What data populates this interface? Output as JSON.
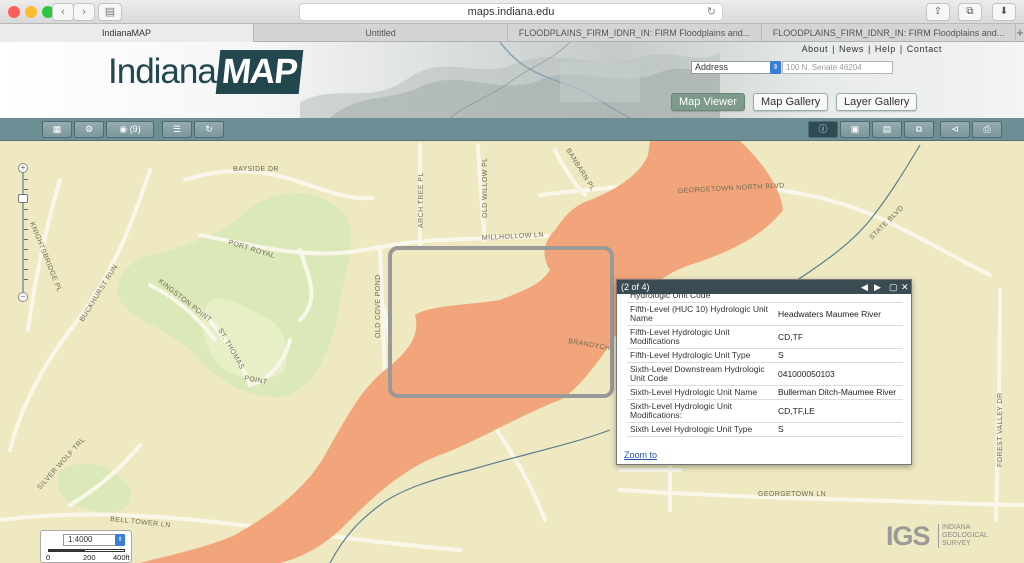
{
  "browser": {
    "url": "maps.indiana.edu",
    "tabs": [
      {
        "label": "IndianaMAP",
        "active": true
      },
      {
        "label": "Untitled",
        "active": false
      },
      {
        "label": "FLOODPLAINS_FIRM_IDNR_IN: FIRM Floodplains and...",
        "active": false
      },
      {
        "label": "FLOODPLAINS_FIRM_IDNR_IN: FIRM Floodplains and...",
        "active": false
      }
    ]
  },
  "header": {
    "logo_part1": "Indiana",
    "logo_part2": "MAP",
    "links": [
      "About",
      "|",
      "News",
      "|",
      "Help",
      "|",
      "Contact"
    ],
    "search_type": "Address",
    "search_placeholder": "100 N. Senate 46204",
    "buttons": {
      "map_viewer": "Map Viewer",
      "map_gallery": "Map Gallery",
      "layer_gallery": "Layer Gallery"
    }
  },
  "toolbar": {
    "layers_count": "(9)"
  },
  "map": {
    "street_labels": [
      "BAYSIDE DR",
      "ARCH TREE PL",
      "OLD WILLOW PL",
      "BANBARN PL",
      "GEORGETOWN NORTH BLVD",
      "STATE BLVD",
      "PORT ROYAL",
      "MILLHOLLOW LN",
      "KNIGHTSBRIDGE PL",
      "BUCKHURST RUN",
      "KINGSTON POINT",
      "ST. THOMAS",
      "POINT",
      "OLD COVE POND",
      "BRANDYCH",
      "SILVER WOLF TRL",
      "BELL TOWER LN",
      "GEORGETOWN LN",
      "FOREST VALLEY DR"
    ]
  },
  "popup": {
    "title": "(2 of 4)",
    "truncated_top": "Hydrologic Unit Code",
    "rows": [
      {
        "key": "Fifth-Level (HUC 10) Hydrologic Unit Name",
        "value": "Headwaters Maumee River"
      },
      {
        "key": "Fifth-Level Hydrologic Unit Modifications",
        "value": "CD,TF"
      },
      {
        "key": "Fifth-Level Hydrologic Unit Type",
        "value": "S"
      },
      {
        "key": "Sixth-Level Downstream Hydrologic Unit Code",
        "value": "041000050103"
      },
      {
        "key": "Sixth-Level Hydrologic Unit Name",
        "value": "Bullerman Ditch-Maumee River"
      },
      {
        "key": "Sixth-Level Hydrologic Unit Modifications:",
        "value": "CD,TF,LE"
      },
      {
        "key": "Sixth Level Hydrologic Unit Type",
        "value": "S"
      }
    ],
    "zoom_to": "Zoom to"
  },
  "scale": {
    "value": "1:4000",
    "labels": [
      "0",
      "200",
      "400ft"
    ]
  },
  "igs": {
    "mark": "IGS",
    "line1": "INDIANA",
    "line2": "GEOLOGICAL",
    "line3": "SURVEY"
  }
}
